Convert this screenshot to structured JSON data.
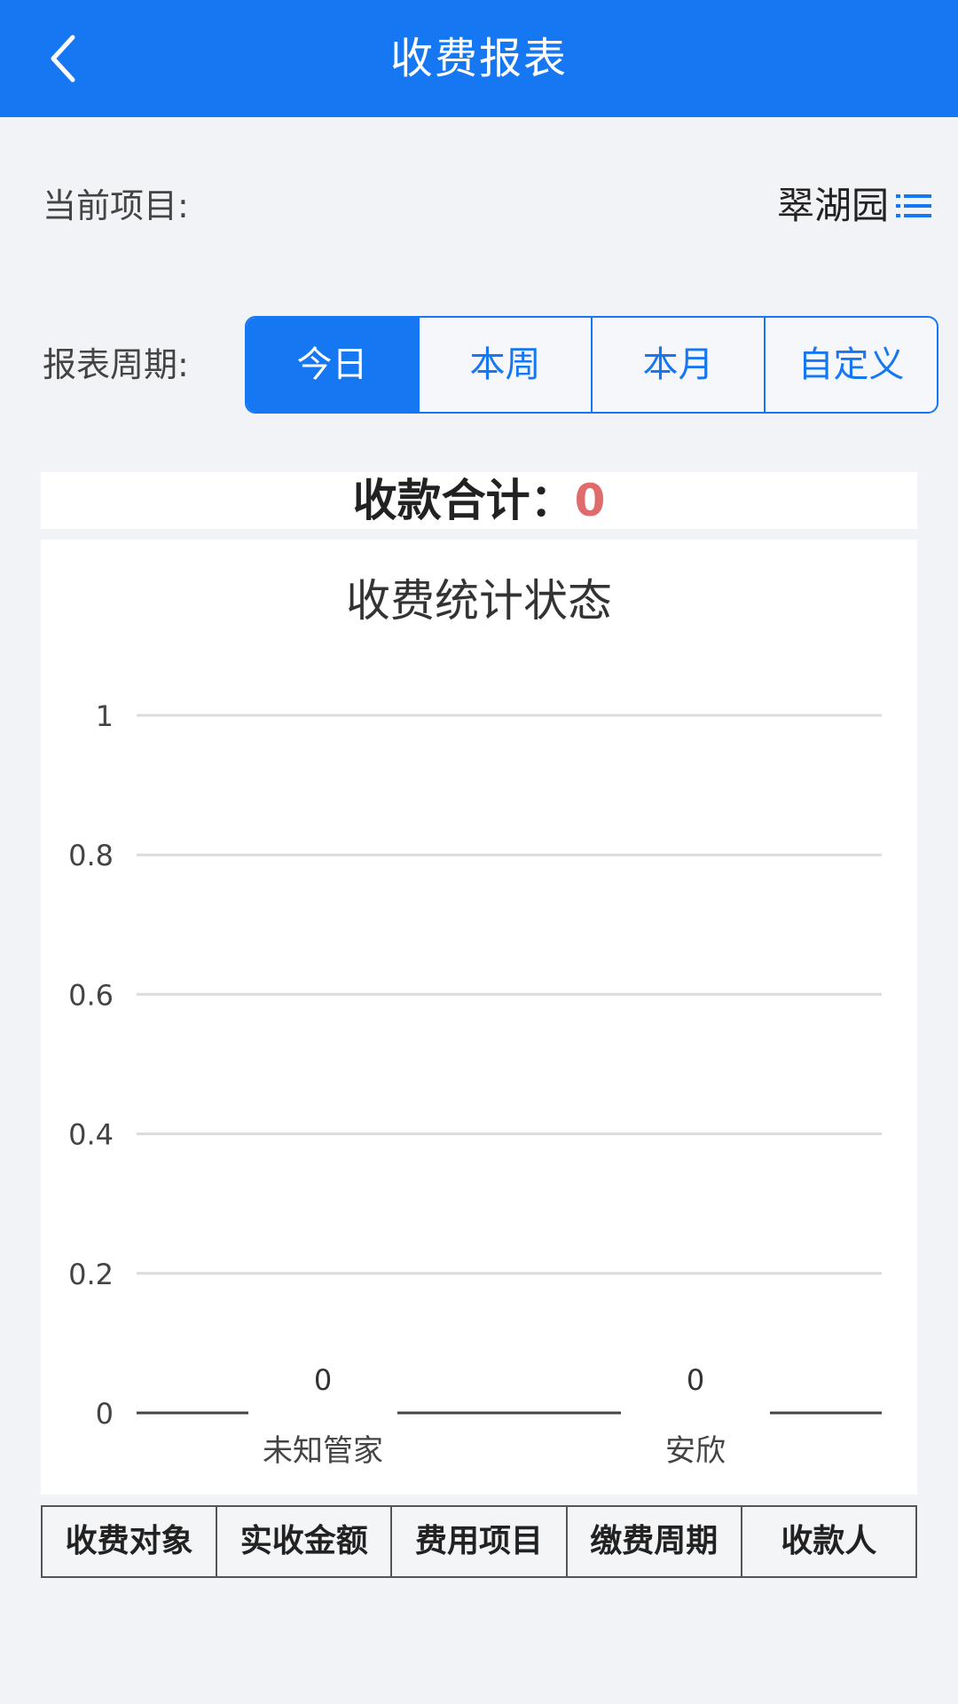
{
  "header": {
    "title": "收费报表",
    "back_icon": "chevron-left-icon"
  },
  "project": {
    "label": "当前项目:",
    "value": "翠湖园",
    "menu_icon": "list-icon"
  },
  "period": {
    "label": "报表周期:",
    "options": [
      "今日",
      "本周",
      "本月",
      "自定义"
    ],
    "selected": "今日"
  },
  "total": {
    "label": "收款合计：",
    "value": "0"
  },
  "colors": {
    "primary": "#1677f2",
    "total_value": "#e06b6b"
  },
  "chart_data": {
    "type": "bar",
    "title": "收费统计状态",
    "categories": [
      "未知管家",
      "安欣"
    ],
    "values": [
      0,
      0
    ],
    "data_labels": [
      "0",
      "0"
    ],
    "ylim": [
      0,
      1
    ],
    "yticks": [
      "0",
      "0.2",
      "0.4",
      "0.6",
      "0.8",
      "1"
    ],
    "grid": true
  },
  "table": {
    "headers": [
      "收费对象",
      "实收金额",
      "费用项目",
      "缴费周期",
      "收款人"
    ]
  }
}
